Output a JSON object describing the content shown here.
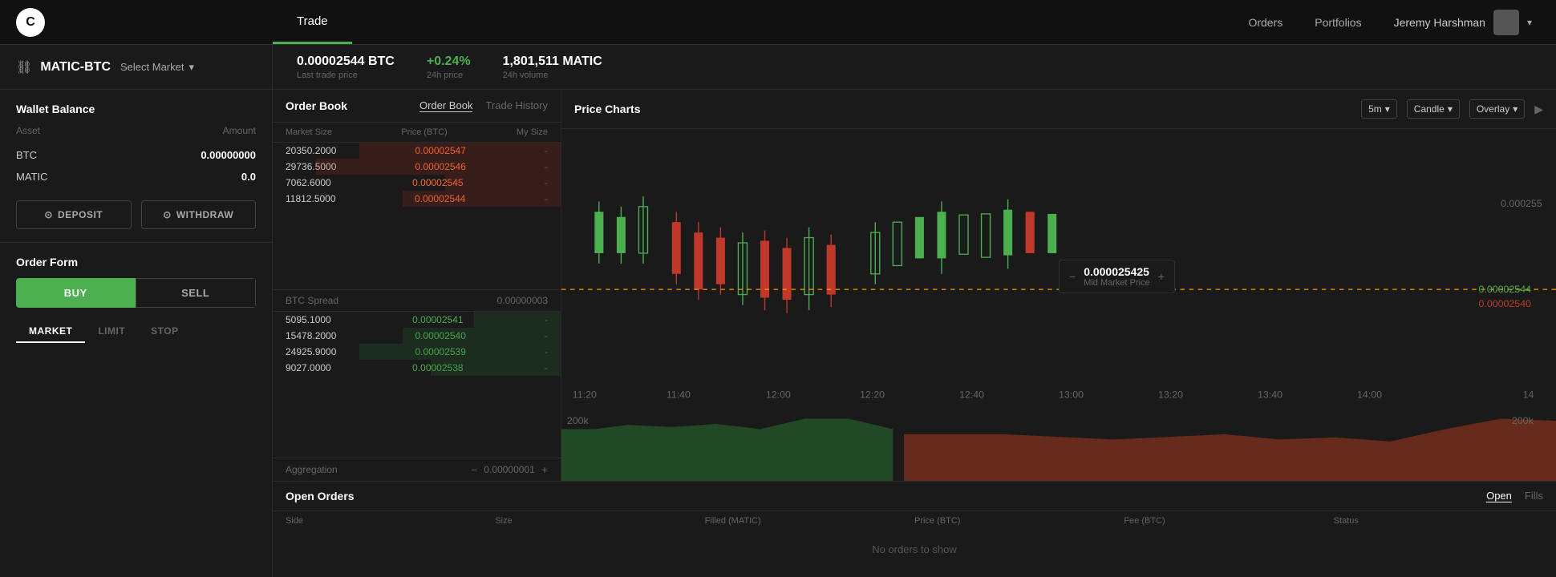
{
  "app": {
    "logo": "C"
  },
  "top_nav": {
    "tabs": [
      {
        "id": "trade",
        "label": "Trade",
        "active": true
      },
      {
        "id": "orders",
        "label": "Orders",
        "active": false
      },
      {
        "id": "portfolios",
        "label": "Portfolios",
        "active": false
      }
    ],
    "user": {
      "name": "Jeremy Harshman",
      "chevron": "▾"
    }
  },
  "market_header": {
    "link_icon": "⛓",
    "market_name": "MATIC-BTC",
    "select_market": "Select Market",
    "chevron": "▾",
    "stats": [
      {
        "id": "last-trade",
        "value": "0.00002544 BTC",
        "label": "Last trade price"
      },
      {
        "id": "24h-price",
        "value": "+0.24%",
        "label": "24h price",
        "color": "green"
      },
      {
        "id": "24h-volume",
        "value": "1,801,511 MATIC",
        "label": "24h volume"
      }
    ]
  },
  "sidebar": {
    "wallet_balance": {
      "title": "Wallet Balance",
      "columns": {
        "asset": "Asset",
        "amount": "Amount"
      },
      "rows": [
        {
          "asset": "BTC",
          "amount": "0.00000000"
        },
        {
          "asset": "MATIC",
          "amount": "0.0"
        }
      ],
      "deposit_label": "DEPOSIT",
      "withdraw_label": "WITHDRAW"
    },
    "order_form": {
      "title": "Order Form",
      "buy_label": "BUY",
      "sell_label": "SELL",
      "order_types": [
        {
          "id": "market",
          "label": "MARKET",
          "active": true
        },
        {
          "id": "limit",
          "label": "LIMIT",
          "active": false
        },
        {
          "id": "stop",
          "label": "STOP",
          "active": false
        }
      ]
    }
  },
  "order_book": {
    "title": "Order Book",
    "tabs": [
      {
        "id": "order-book",
        "label": "Order Book",
        "active": true
      },
      {
        "id": "trade-history",
        "label": "Trade History",
        "active": false
      }
    ],
    "columns": {
      "market_size": "Market Size",
      "price_btc": "Price (BTC)",
      "my_size": "My Size"
    },
    "sell_rows": [
      {
        "size": "20350.2000",
        "price": "0.00002547",
        "mysize": "-",
        "bar_pct": 70
      },
      {
        "size": "29736.5000",
        "price": "0.00002546",
        "mysize": "-",
        "bar_pct": 85
      },
      {
        "size": "7062.6000",
        "price": "0.00002545",
        "mysize": "-",
        "bar_pct": 40
      },
      {
        "size": "11812.5000",
        "price": "0.00002544",
        "mysize": "-",
        "bar_pct": 55
      }
    ],
    "spread": {
      "label": "BTC Spread",
      "value": "0.00000003"
    },
    "buy_rows": [
      {
        "size": "5095.1000",
        "price": "0.00002541",
        "mysize": "-",
        "bar_pct": 30
      },
      {
        "size": "15478.2000",
        "price": "0.00002540",
        "mysize": "-",
        "bar_pct": 55
      },
      {
        "size": "24925.9000",
        "price": "0.00002539",
        "mysize": "-",
        "bar_pct": 70
      },
      {
        "size": "9027.0000",
        "price": "0.00002538",
        "mysize": "-",
        "bar_pct": 45
      }
    ],
    "aggregation": {
      "label": "Aggregation",
      "value": "0.00000001"
    }
  },
  "price_charts": {
    "title": "Price Charts",
    "controls": [
      {
        "id": "timeframe",
        "label": "5m",
        "chevron": "▾"
      },
      {
        "id": "candle-type",
        "label": "Candle",
        "chevron": "▾"
      },
      {
        "id": "overlay",
        "label": "Overlay",
        "chevron": "▾"
      }
    ],
    "time_labels": [
      "11:20",
      "11:40",
      "12:00",
      "12:20",
      "12:40",
      "13:00",
      "13:20",
      "13:40",
      "14:00",
      "14"
    ],
    "price_labels": [
      "0.000255",
      "0.00002544",
      "0.00002540"
    ],
    "mid_market": {
      "price": "0.000025425",
      "label": "Mid Market Price"
    },
    "volume_label": "200k",
    "right_arrow": "▶"
  },
  "open_orders": {
    "title": "Open Orders",
    "tabs": [
      {
        "id": "open",
        "label": "Open",
        "active": true
      },
      {
        "id": "fills",
        "label": "Fills",
        "active": false
      }
    ],
    "columns": [
      "Side",
      "Size",
      "Filled (MATIC)",
      "Price (BTC)",
      "Fee (BTC)",
      "Status"
    ],
    "no_orders": "No orders to show"
  }
}
